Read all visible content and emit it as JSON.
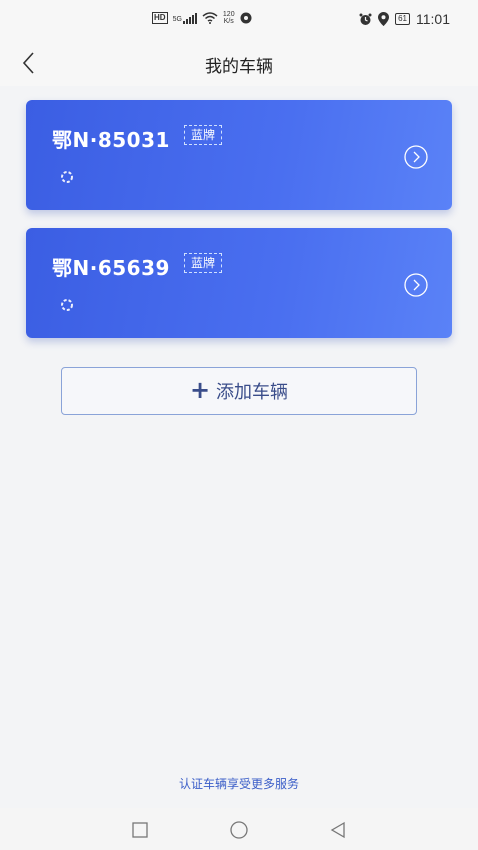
{
  "status_bar": {
    "hd_label": "HD",
    "signal_label": "5G",
    "net_speed_value": "120",
    "net_speed_unit": "K/s",
    "battery": "61",
    "time": "11:01"
  },
  "nav": {
    "title": "我的车辆"
  },
  "vehicles": [
    {
      "plate": "鄂N·85031",
      "tag": "蓝牌"
    },
    {
      "plate": "鄂N·65639",
      "tag": "蓝牌"
    }
  ],
  "add_button": {
    "label": "添加车辆"
  },
  "footer": {
    "link": "认证车辆享受更多服务"
  },
  "colors": {
    "card_start": "#3b5ee3",
    "card_end": "#5a82f7",
    "accent": "#3b5ec8"
  }
}
